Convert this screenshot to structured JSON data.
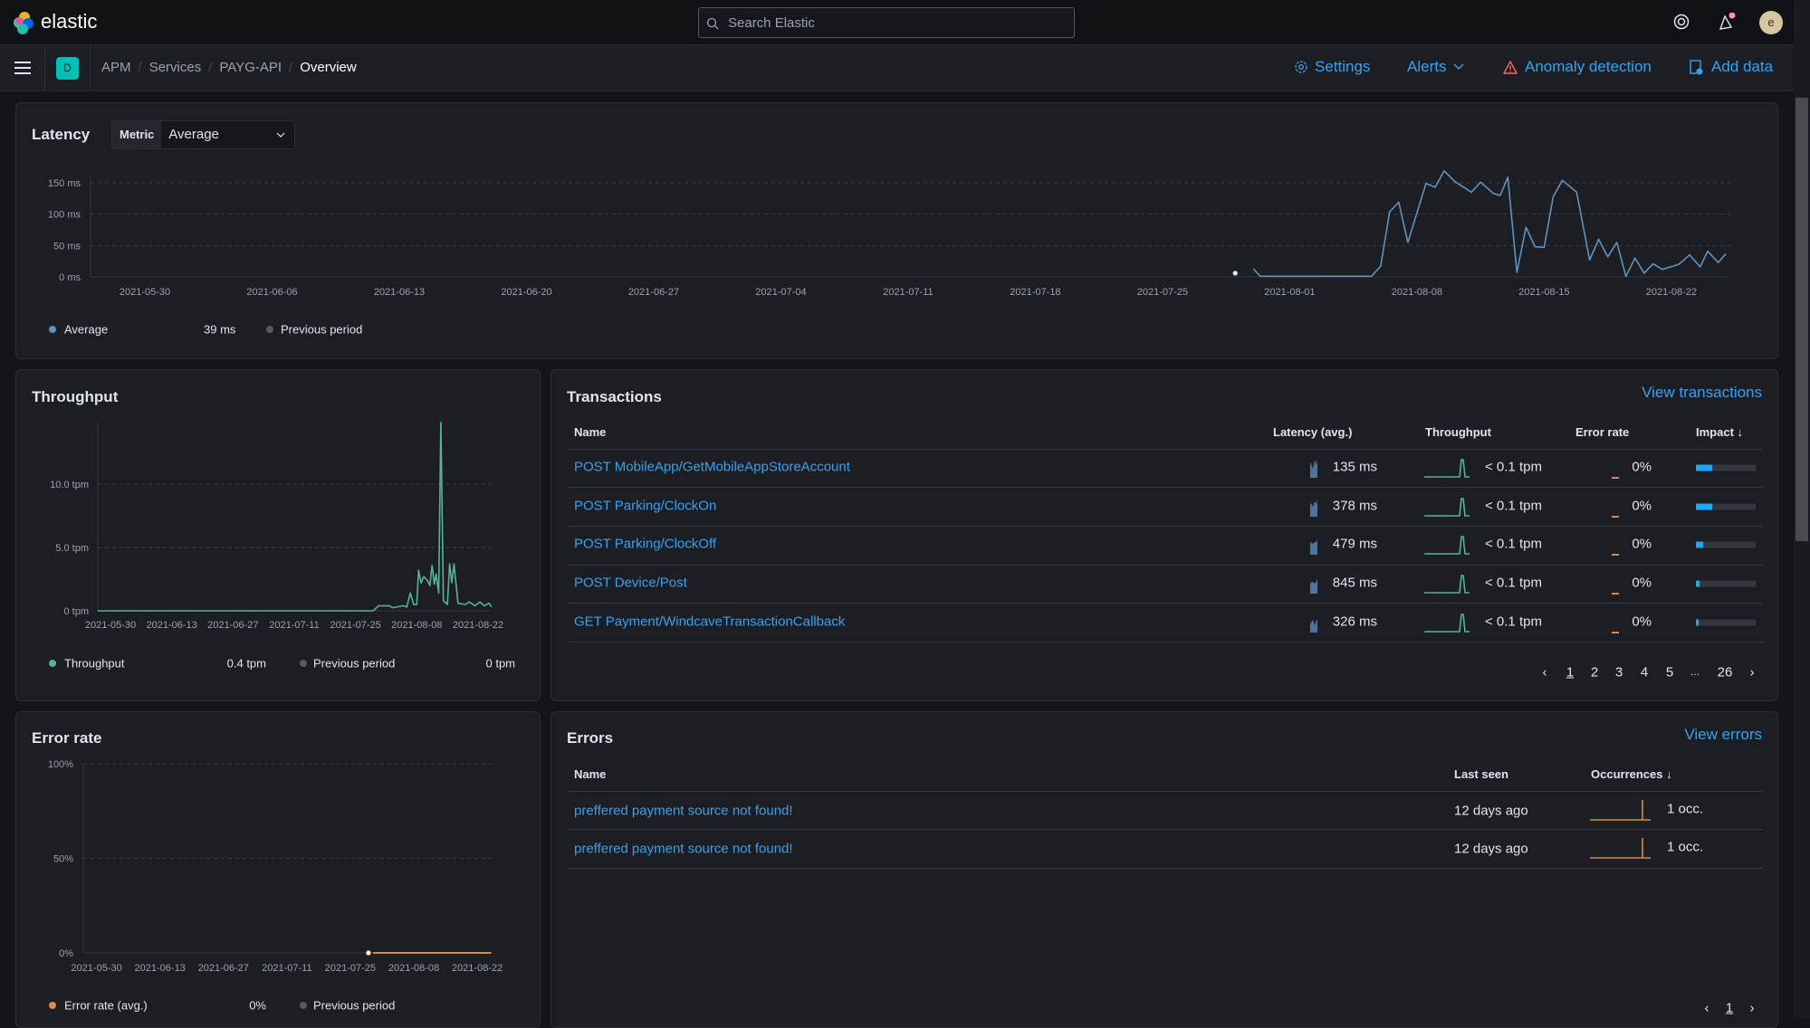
{
  "header": {
    "logo_text": "elastic",
    "search_placeholder": "Search Elastic",
    "avatar_initial": "e"
  },
  "breadcrumb": {
    "space_badge": "D",
    "items": [
      "APM",
      "Services",
      "PAYG-API",
      "Overview"
    ]
  },
  "actions": {
    "settings": "Settings",
    "alerts": "Alerts",
    "anomaly": "Anomaly detection",
    "add_data": "Add data"
  },
  "colors": {
    "accent": "#36a2ef",
    "latency": "#6092c0",
    "throughput": "#54b399",
    "error": "#da8b45",
    "impact": "#1ba9f5",
    "anomaly_icon": "#ff6666",
    "space_badge": "#00bfb3"
  },
  "latency": {
    "title": "Latency",
    "metric_label": "Metric",
    "metric_value": "Average",
    "legend": {
      "series": "Average",
      "value": "39 ms",
      "previous": "Previous period"
    }
  },
  "throughput": {
    "title": "Throughput",
    "legend": {
      "series": "Throughput",
      "value": "0.4 tpm",
      "previous": "Previous period",
      "previous_value": "0 tpm"
    }
  },
  "error_rate": {
    "title": "Error rate",
    "legend": {
      "series": "Error rate (avg.)",
      "value": "0%",
      "previous": "Previous period"
    }
  },
  "chart_data": [
    {
      "type": "line",
      "id": "latency",
      "yticks": [
        "0 ms",
        "50 ms",
        "100 ms",
        "150 ms"
      ],
      "ytick_values": [
        0,
        50,
        100,
        150
      ],
      "ylim": [
        0,
        150
      ],
      "unit": "ms",
      "grid": true,
      "xticks": [
        "2021-05-30",
        "2021-06-06",
        "2021-06-13",
        "2021-06-20",
        "2021-06-27",
        "2021-07-04",
        "2021-07-11",
        "2021-07-18",
        "2021-07-25",
        "2021-08-01",
        "2021-08-08",
        "2021-08-15",
        "2021-08-22"
      ],
      "isolated_points": [
        [
          "2021-07-29T00:00",
          6
        ]
      ],
      "series": [
        {
          "name": "Average",
          "values": [
            [
              "2021-07-30T00:00",
              13
            ],
            [
              "2021-07-30T09:00",
              1
            ],
            [
              "2021-08-05T12:00",
              1
            ],
            [
              "2021-08-06T00:00",
              17
            ],
            [
              "2021-08-06T12:00",
              104
            ],
            [
              "2021-08-07T00:00",
              119
            ],
            [
              "2021-08-07T12:00",
              55
            ],
            [
              "2021-08-08T12:00",
              149
            ],
            [
              "2021-08-09T00:00",
              143
            ],
            [
              "2021-08-09T12:00",
              169
            ],
            [
              "2021-08-10T02:00",
              152
            ],
            [
              "2021-08-11T00:00",
              135
            ],
            [
              "2021-08-11T12:00",
              151
            ],
            [
              "2021-08-12T05:00",
              133
            ],
            [
              "2021-08-12T14:00",
              130
            ],
            [
              "2021-08-13T00:00",
              159
            ],
            [
              "2021-08-13T12:00",
              7
            ],
            [
              "2021-08-14T00:00",
              79
            ],
            [
              "2021-08-14T12:00",
              48
            ],
            [
              "2021-08-15T00:00",
              47
            ],
            [
              "2021-08-15T12:00",
              128
            ],
            [
              "2021-08-16T00:00",
              154
            ],
            [
              "2021-08-16T19:00",
              135
            ],
            [
              "2021-08-17T12:00",
              27
            ],
            [
              "2021-08-18T00:00",
              60
            ],
            [
              "2021-08-18T12:00",
              32
            ],
            [
              "2021-08-19T00:00",
              55
            ],
            [
              "2021-08-19T12:00",
              1
            ],
            [
              "2021-08-20T00:00",
              30
            ],
            [
              "2021-08-20T12:00",
              6
            ],
            [
              "2021-08-21T00:00",
              21
            ],
            [
              "2021-08-21T12:00",
              12
            ],
            [
              "2021-08-22T10:00",
              20
            ],
            [
              "2021-08-23T00:00",
              35
            ],
            [
              "2021-08-23T14:00",
              16
            ],
            [
              "2021-08-24T00:00",
              41
            ],
            [
              "2021-08-24T14:00",
              23
            ],
            [
              "2021-08-25T00:00",
              37
            ]
          ]
        }
      ]
    },
    {
      "type": "line",
      "id": "throughput",
      "yticks": [
        "0 tpm",
        "5.0 tpm",
        "10.0 tpm"
      ],
      "ytick_values": [
        0,
        5,
        10
      ],
      "ylim": [
        0,
        15
      ],
      "grid": true,
      "xticks": [
        "2021-05-30",
        "2021-06-13",
        "2021-06-27",
        "2021-07-11",
        "2021-07-25",
        "2021-08-08",
        "2021-08-22"
      ],
      "series": [
        {
          "name": "Throughput",
          "values": [
            [
              "2021-05-27T02:00",
              0
            ],
            [
              "2021-07-29T00:00",
              0
            ],
            [
              "2021-07-30T07:00",
              0.4
            ],
            [
              "2021-08-01T17:00",
              0.4
            ],
            [
              "2021-08-02T12:00",
              0.24
            ],
            [
              "2021-08-04T22:00",
              0.4
            ],
            [
              "2021-08-05T17:00",
              0.3
            ],
            [
              "2021-08-06T12:00",
              1.4
            ],
            [
              "2021-08-07T07:00",
              0.5
            ],
            [
              "2021-08-08T00:00",
              0.5
            ],
            [
              "2021-08-08T10:00",
              3.2
            ],
            [
              "2021-08-09T00:00",
              2.2
            ],
            [
              "2021-08-09T14:00",
              2.7
            ],
            [
              "2021-08-10T10:00",
              2.4
            ],
            [
              "2021-08-11T00:00",
              2.0
            ],
            [
              "2021-08-11T12:00",
              3.6
            ],
            [
              "2021-08-12T00:00",
              2.1
            ],
            [
              "2021-08-12T10:00",
              2.9
            ],
            [
              "2021-08-13T00:00",
              1.4
            ],
            [
              "2021-08-13T12:00",
              14.9
            ],
            [
              "2021-08-14T02:00",
              0.8
            ],
            [
              "2021-08-15T00:00",
              0.5
            ],
            [
              "2021-08-15T12:00",
              3.7
            ],
            [
              "2021-08-16T00:00",
              2.2
            ],
            [
              "2021-08-16T12:00",
              3.7
            ],
            [
              "2021-08-17T10:00",
              0.6
            ],
            [
              "2021-08-19T02:00",
              0.5
            ],
            [
              "2021-08-20T00:00",
              0.7
            ],
            [
              "2021-08-21T07:00",
              0.4
            ],
            [
              "2021-08-22T10:00",
              0.7
            ],
            [
              "2021-08-23T10:00",
              0.4
            ],
            [
              "2021-08-24T12:00",
              0.6
            ],
            [
              "2021-08-25T02:00",
              0.3
            ]
          ]
        }
      ]
    },
    {
      "type": "line",
      "id": "error_rate",
      "yticks": [
        "0%",
        "50%",
        "100%"
      ],
      "ytick_values": [
        0,
        50,
        100
      ],
      "ylim": [
        0,
        100
      ],
      "grid": true,
      "xticks": [
        "2021-05-30",
        "2021-06-13",
        "2021-06-27",
        "2021-07-11",
        "2021-07-25",
        "2021-08-08",
        "2021-08-22"
      ],
      "isolated_points": [
        [
          "2021-07-29T00:00",
          0
        ]
      ],
      "series": [
        {
          "name": "Error rate (avg.)",
          "values": [
            [
              "2021-07-30T00:00",
              0
            ],
            [
              "2021-08-25T02:00",
              0
            ]
          ]
        }
      ]
    }
  ],
  "transactions": {
    "title": "Transactions",
    "view_link": "View transactions",
    "columns": [
      "Name",
      "Latency (avg.)",
      "Throughput",
      "Error rate",
      "Impact"
    ],
    "rows": [
      {
        "name": "POST MobileApp/GetMobileAppStoreAccount",
        "latency": "135 ms",
        "throughput": "< 0.1 tpm",
        "error_rate": "0%",
        "impact": 0.28
      },
      {
        "name": "POST Parking/ClockOn",
        "latency": "378 ms",
        "throughput": "< 0.1 tpm",
        "error_rate": "0%",
        "impact": 0.27
      },
      {
        "name": "POST Parking/ClockOff",
        "latency": "479 ms",
        "throughput": "< 0.1 tpm",
        "error_rate": "0%",
        "impact": 0.12
      },
      {
        "name": "POST Device/Post",
        "latency": "845 ms",
        "throughput": "< 0.1 tpm",
        "error_rate": "0%",
        "impact": 0.06
      },
      {
        "name": "GET Payment/WindcaveTransactionCallback",
        "latency": "326 ms",
        "throughput": "< 0.1 tpm",
        "error_rate": "0%",
        "impact": 0.05
      }
    ],
    "pagination": {
      "current": "1",
      "pages": [
        "1",
        "2",
        "3",
        "4",
        "5"
      ],
      "ellipsis": "…",
      "last": "26"
    }
  },
  "errors": {
    "title": "Errors",
    "view_link": "View errors",
    "columns": [
      "Name",
      "Last seen",
      "Occurrences"
    ],
    "rows": [
      {
        "name": "preffered payment source not found!",
        "last_seen": "12 days ago",
        "occurrences": "1 occ."
      },
      {
        "name": "preffered payment source not found!",
        "last_seen": "12 days ago",
        "occurrences": "1 occ."
      }
    ],
    "pagination": {
      "current": "1"
    }
  }
}
